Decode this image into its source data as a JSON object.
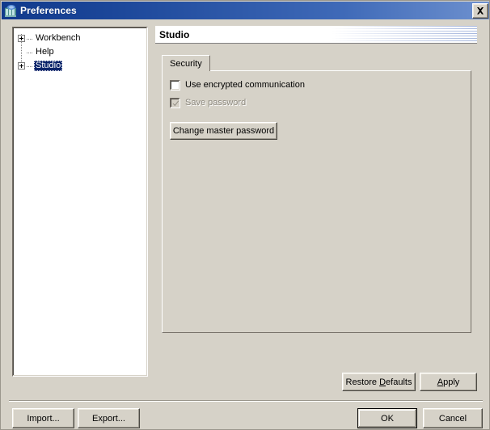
{
  "window": {
    "title": "Preferences",
    "icon": "preferences-window-icon",
    "close_icon": "close-icon",
    "titlebar_gradient_from": "#113a8c",
    "titlebar_gradient_to": "#6e91cf",
    "face_color": "#d6d2c8"
  },
  "tree": {
    "items": [
      {
        "label": "Workbench",
        "expandable": true,
        "expanded": false,
        "selected": false
      },
      {
        "label": "Help",
        "expandable": false,
        "expanded": false,
        "selected": false
      },
      {
        "label": "Studio",
        "expandable": true,
        "expanded": false,
        "selected": true
      }
    ],
    "selection_color": "#0a246a"
  },
  "page": {
    "title": "Studio",
    "tabs": [
      {
        "label": "Security",
        "selected": true
      }
    ],
    "security": {
      "checkboxes": [
        {
          "label": "Use encrypted communication",
          "checked": false,
          "enabled": true
        },
        {
          "label": "Save password",
          "checked": true,
          "enabled": false
        }
      ],
      "change_master_password_label": "Change master password"
    }
  },
  "page_buttons": {
    "restore_defaults_label": "Restore ",
    "restore_defaults_mnemonic": "D",
    "restore_defaults_rest": "efaults",
    "apply_mnemonic": "A",
    "apply_rest": "pply"
  },
  "dialog_buttons": {
    "import_label": "Import...",
    "export_label": "Export...",
    "ok_label": "OK",
    "cancel_label": "Cancel",
    "default_button": "OK"
  }
}
